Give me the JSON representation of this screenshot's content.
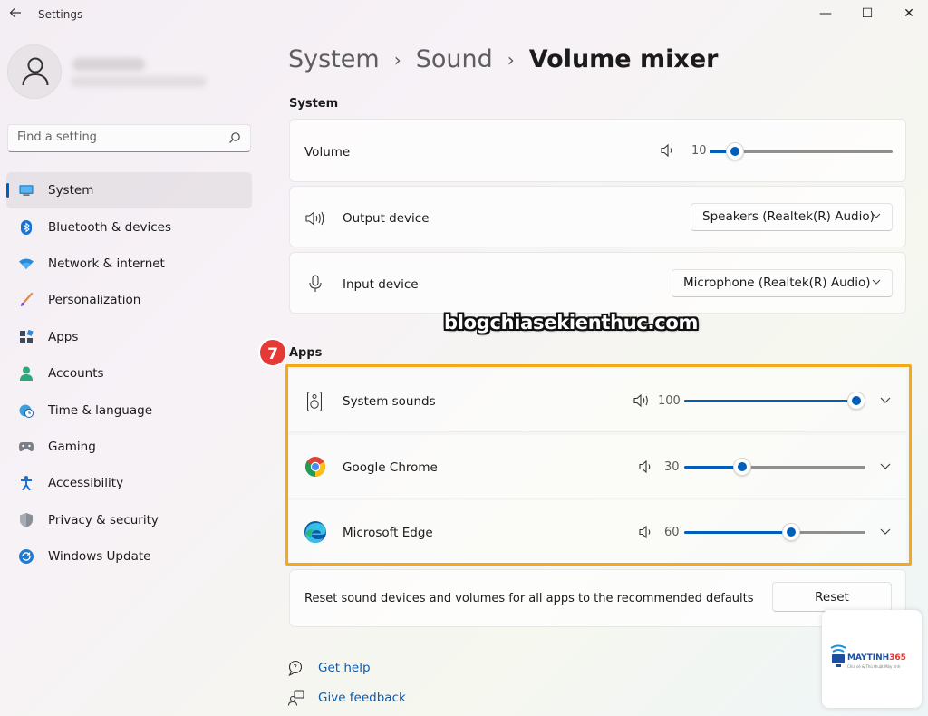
{
  "window": {
    "title": "Settings",
    "back_icon": "back-arrow-icon",
    "minimize_glyph": "—",
    "maximize_glyph": "☐",
    "close_glyph": "✕"
  },
  "search": {
    "placeholder": "Find a setting"
  },
  "sidebar": {
    "items": [
      {
        "label": "System",
        "icon": "system-icon",
        "active": true
      },
      {
        "label": "Bluetooth & devices",
        "icon": "bluetooth-icon"
      },
      {
        "label": "Network & internet",
        "icon": "wifi-icon"
      },
      {
        "label": "Personalization",
        "icon": "brush-icon"
      },
      {
        "label": "Apps",
        "icon": "apps-icon"
      },
      {
        "label": "Accounts",
        "icon": "person-icon"
      },
      {
        "label": "Time & language",
        "icon": "globe-clock-icon"
      },
      {
        "label": "Gaming",
        "icon": "gamepad-icon"
      },
      {
        "label": "Accessibility",
        "icon": "accessibility-icon"
      },
      {
        "label": "Privacy & security",
        "icon": "shield-icon"
      },
      {
        "label": "Windows Update",
        "icon": "update-icon"
      }
    ]
  },
  "breadcrumb": {
    "parts": [
      "System",
      "Sound"
    ],
    "separator": "›",
    "current": "Volume mixer"
  },
  "system_section": {
    "title": "System",
    "volume": {
      "label": "Volume",
      "value": 10,
      "value_text": "10"
    },
    "output_device": {
      "label": "Output device",
      "selected": "Speakers (Realtek(R) Audio)"
    },
    "input_device": {
      "label": "Input device",
      "selected": "Microphone (Realtek(R) Audio)"
    }
  },
  "watermark": "blogchiasekienthuc.com",
  "step_badge": "7",
  "apps_section": {
    "title": "Apps",
    "apps": [
      {
        "name": "System sounds",
        "icon": "speaker-box-icon",
        "volume": 100,
        "volume_text": "100"
      },
      {
        "name": "Google Chrome",
        "icon": "chrome-icon",
        "volume": 30,
        "volume_text": "30"
      },
      {
        "name": "Microsoft Edge",
        "icon": "edge-icon",
        "volume": 60,
        "volume_text": "60"
      }
    ]
  },
  "reset": {
    "description": "Reset sound devices and volumes for all apps to the recommended defaults",
    "button_label": "Reset"
  },
  "links": {
    "get_help": "Get help",
    "give_feedback": "Give feedback"
  },
  "corner_logo": {
    "brand_main": "MAYTINH",
    "brand_accent": "365",
    "tagline": "Chia sẻ & Thủ thuật Máy tính"
  },
  "colors": {
    "accent": "#005fb8",
    "highlight": "#f4a91a",
    "badge": "#e53935",
    "link": "#0a5bb0"
  }
}
